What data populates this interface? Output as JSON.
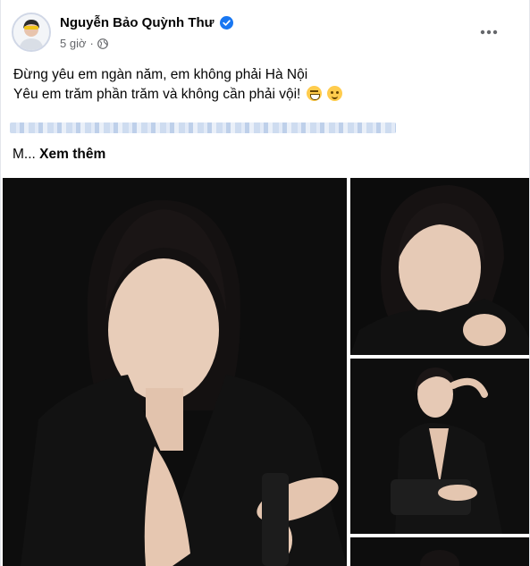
{
  "post": {
    "author": "Nguyễn Bảo Quỳnh Thư",
    "time": "5 giờ",
    "privacy_icon": "globe-icon",
    "verified_icon": "verified-badge-icon",
    "more_icon": "more-options-icon",
    "line1": "Đừng yêu em ngàn năm, em không phải Hà Nội",
    "line2": "Yêu em trăm phần trăm và không cần phải vội!",
    "emojis": [
      "grinning-squint-emoji",
      "smirk-emoji"
    ],
    "truncated_prefix": "M...",
    "see_more_label": "Xem thêm"
  },
  "photos": [
    {
      "name": "main-photo"
    },
    {
      "name": "photo-2"
    },
    {
      "name": "photo-3"
    },
    {
      "name": "photo-4"
    }
  ],
  "colors": {
    "verified": "#1877f2",
    "secondary_text": "#65676b",
    "primary_text": "#050505"
  }
}
